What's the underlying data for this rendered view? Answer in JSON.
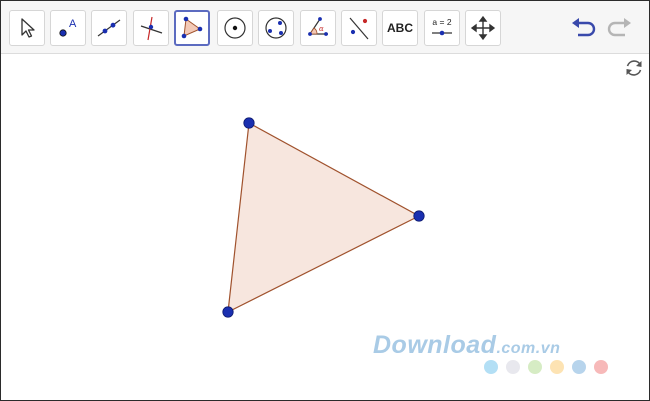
{
  "toolbar": {
    "tools": [
      {
        "name": "move-tool",
        "icon": "arrow-cursor-icon"
      },
      {
        "name": "point-tool",
        "icon": "point-a-icon"
      },
      {
        "name": "line-tool",
        "icon": "line-through-points-icon"
      },
      {
        "name": "perpendicular-line-tool",
        "icon": "perpendicular-lines-icon"
      },
      {
        "name": "polygon-tool",
        "icon": "polygon-icon",
        "selected": true
      },
      {
        "name": "circle-center-point-tool",
        "icon": "circle-center-icon"
      },
      {
        "name": "circle-three-points-tool",
        "icon": "circle-three-points-icon"
      },
      {
        "name": "angle-tool",
        "icon": "angle-icon"
      },
      {
        "name": "reflect-about-line-tool",
        "icon": "reflect-line-icon"
      },
      {
        "name": "text-tool",
        "icon": "text-icon",
        "label": "ABC"
      },
      {
        "name": "slider-tool",
        "icon": "slider-icon",
        "label": "a = 2"
      },
      {
        "name": "move-graphics-view-tool",
        "icon": "move-arrows-icon"
      }
    ],
    "undo_icon": "undo-icon",
    "redo_icon": "redo-icon",
    "accent_color": "#5c6bc0"
  },
  "graphics": {
    "refresh_icon": "refresh-icon",
    "triangle": {
      "fill_color": "#f7e6de",
      "edge_color": "#a0522d",
      "vertex_color": "#1a2fb0"
    }
  },
  "watermark": {
    "text": "Download",
    "suffix": ".com.vn",
    "dot_colors": [
      "#b3dff5",
      "#e8e8ee",
      "#d6ecc4",
      "#fde3b3",
      "#b7d4ec",
      "#f7b9b9"
    ]
  }
}
